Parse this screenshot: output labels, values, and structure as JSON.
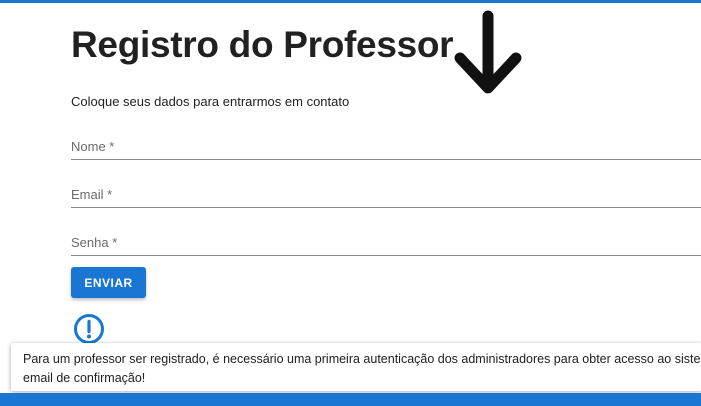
{
  "form": {
    "title": "Registro do Professor",
    "subtitle": "Coloque seus dados para entrarmos em contato",
    "fields": [
      {
        "label": "Nome *",
        "value": ""
      },
      {
        "label": "Email *",
        "value": ""
      },
      {
        "label": "Senha *",
        "value": ""
      }
    ],
    "submit_label": "ENVIAR"
  },
  "notice": {
    "icon": "exclamation-circle-icon",
    "text": "Para um professor ser registrado, é necessário uma primeira autenticação dos administradores para obter acesso ao sistema, um email de confirmação!"
  },
  "annotation": {
    "icon": "arrow-down-icon"
  },
  "colors": {
    "primary": "#1976d2",
    "text": "#212121",
    "label": "#6b6b6b"
  }
}
